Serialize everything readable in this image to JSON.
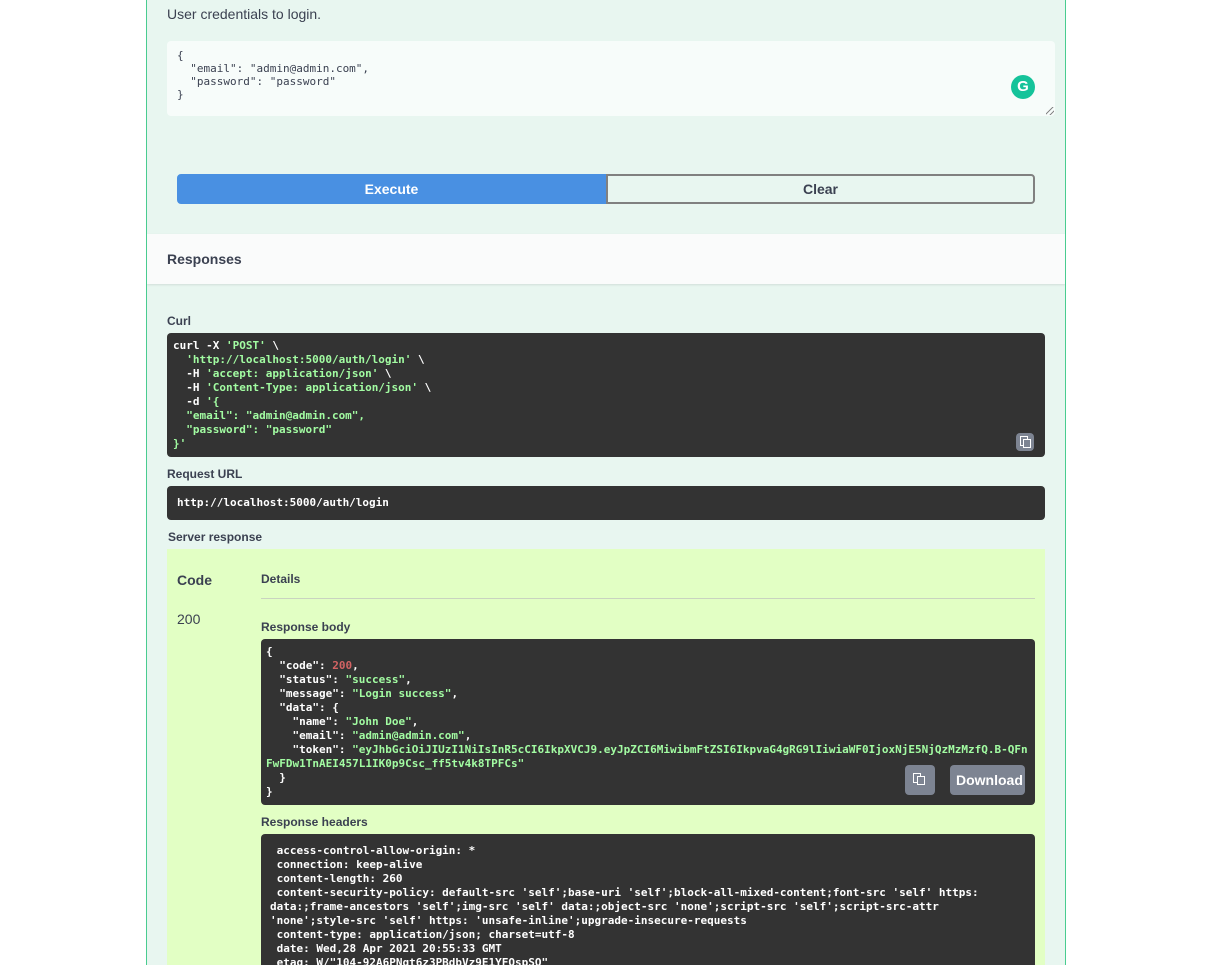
{
  "request": {
    "description": "User credentials to login.",
    "body_lines": [
      "{",
      "  \"email\": \"admin@admin.com\",",
      "  \"password\": \"password\"",
      "}"
    ]
  },
  "buttons": {
    "execute": "Execute",
    "clear": "Clear",
    "download": "Download"
  },
  "responses": {
    "title": "Responses",
    "curl_label": "Curl",
    "request_url_label": "Request URL",
    "request_url": "http://localhost:5000/auth/login",
    "server_response_label": "Server response",
    "code_header": "Code",
    "details_header": "Details",
    "code": "200",
    "response_body_label": "Response body",
    "response_headers_label": "Response headers"
  },
  "curl": [
    [
      {
        "t": "curl -X "
      },
      {
        "t": "'POST'",
        "c": "s"
      },
      {
        "t": " \\"
      }
    ],
    [
      {
        "t": "  "
      },
      {
        "t": "'http://localhost:5000/auth/login'",
        "c": "s"
      },
      {
        "t": " \\"
      }
    ],
    [
      {
        "t": "  -H "
      },
      {
        "t": "'accept: application/json'",
        "c": "s"
      },
      {
        "t": " \\"
      }
    ],
    [
      {
        "t": "  -H "
      },
      {
        "t": "'Content-Type: application/json'",
        "c": "s"
      },
      {
        "t": " \\"
      }
    ],
    [
      {
        "t": "  -d "
      },
      {
        "t": "'{",
        "c": "s"
      }
    ],
    [
      {
        "t": "  \"email\": \"admin@admin.com\",",
        "c": "s"
      }
    ],
    [
      {
        "t": "  \"password\": \"password\"",
        "c": "s"
      }
    ],
    [
      {
        "t": "}'",
        "c": "s"
      }
    ]
  ],
  "response_body": [
    [
      {
        "t": "{"
      }
    ],
    [
      {
        "t": "  \"code\": "
      },
      {
        "t": "200",
        "c": "n"
      },
      {
        "t": ","
      }
    ],
    [
      {
        "t": "  \"status\": "
      },
      {
        "t": "\"success\"",
        "c": "s"
      },
      {
        "t": ","
      }
    ],
    [
      {
        "t": "  \"message\": "
      },
      {
        "t": "\"Login success\"",
        "c": "s"
      },
      {
        "t": ","
      }
    ],
    [
      {
        "t": "  \"data\": {"
      }
    ],
    [
      {
        "t": "    \"name\": "
      },
      {
        "t": "\"John Doe\"",
        "c": "s"
      },
      {
        "t": ","
      }
    ],
    [
      {
        "t": "    \"email\": "
      },
      {
        "t": "\"admin@admin.com\"",
        "c": "s"
      },
      {
        "t": ","
      }
    ],
    [
      {
        "t": "    \"token\": "
      },
      {
        "t": "\"eyJhbGciOiJIUzI1NiIsInR5cCI6IkpXVCJ9.eyJpZCI6MiwibmFtZSI6IkpvaG4gRG9lIiwiaWF0IjoxNjE5NjQzMzMzfQ.B-QFn",
        "c": "s"
      }
    ],
    [
      {
        "t": "FwFDw1TnAEI457L1IK0p9Csc_ff5tv4k8TPFCs\"",
        "c": "s"
      }
    ],
    [
      {
        "t": "  }"
      }
    ],
    [
      {
        "t": "}"
      }
    ]
  ],
  "response_headers": [
    " access-control-allow-origin: *",
    " connection: keep-alive",
    " content-length: 260",
    " content-security-policy: default-src 'self';base-uri 'self';block-all-mixed-content;font-src 'self' https:",
    "data:;frame-ancestors 'self';img-src 'self' data:;object-src 'none';script-src 'self';script-src-attr",
    "'none';style-src 'self' https: 'unsafe-inline';upgrade-insecure-requests",
    " content-type: application/json; charset=utf-8",
    " date: Wed,28 Apr 2021 20:55:33 GMT",
    " etag: W/\"104-92A6PNgt6z3PBdbVz9E1YFQspSQ\""
  ]
}
